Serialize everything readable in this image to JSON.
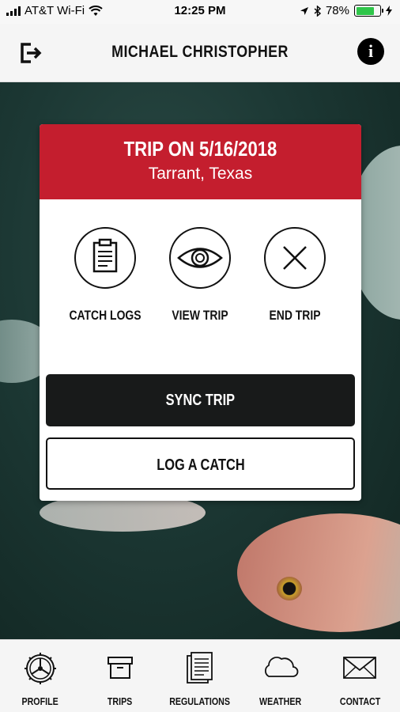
{
  "status_bar": {
    "carrier": "AT&T Wi-Fi",
    "time": "12:25 PM",
    "battery_percent": "78%",
    "battery_level": 0.78,
    "icons": [
      "signal-icon",
      "wifi-icon",
      "location-icon",
      "bluetooth-icon",
      "battery-icon",
      "charging-icon"
    ]
  },
  "header": {
    "title": "MICHAEL CHRISTOPHER",
    "info_glyph": "i",
    "icons": [
      "logout-icon",
      "info-icon"
    ]
  },
  "card": {
    "title": "TRIP ON 5/16/2018",
    "subtitle": "Tarrant, Texas",
    "accent_color": "#c41e2e",
    "actions": [
      {
        "label": "CATCH LOGS",
        "icon": "clipboard-icon"
      },
      {
        "label": "VIEW TRIP",
        "icon": "eye-icon"
      },
      {
        "label": "END TRIP",
        "icon": "x-icon"
      }
    ],
    "sync_button": "SYNC TRIP",
    "log_button": "LOG A CATCH"
  },
  "tabbar": {
    "tabs": [
      {
        "label": "PROFILE",
        "icon": "wheel-icon"
      },
      {
        "label": "TRIPS",
        "icon": "box-icon"
      },
      {
        "label": "REGULATIONS",
        "icon": "document-icon"
      },
      {
        "label": "WEATHER",
        "icon": "cloud-icon"
      },
      {
        "label": "CONTACT",
        "icon": "envelope-icon"
      }
    ]
  }
}
